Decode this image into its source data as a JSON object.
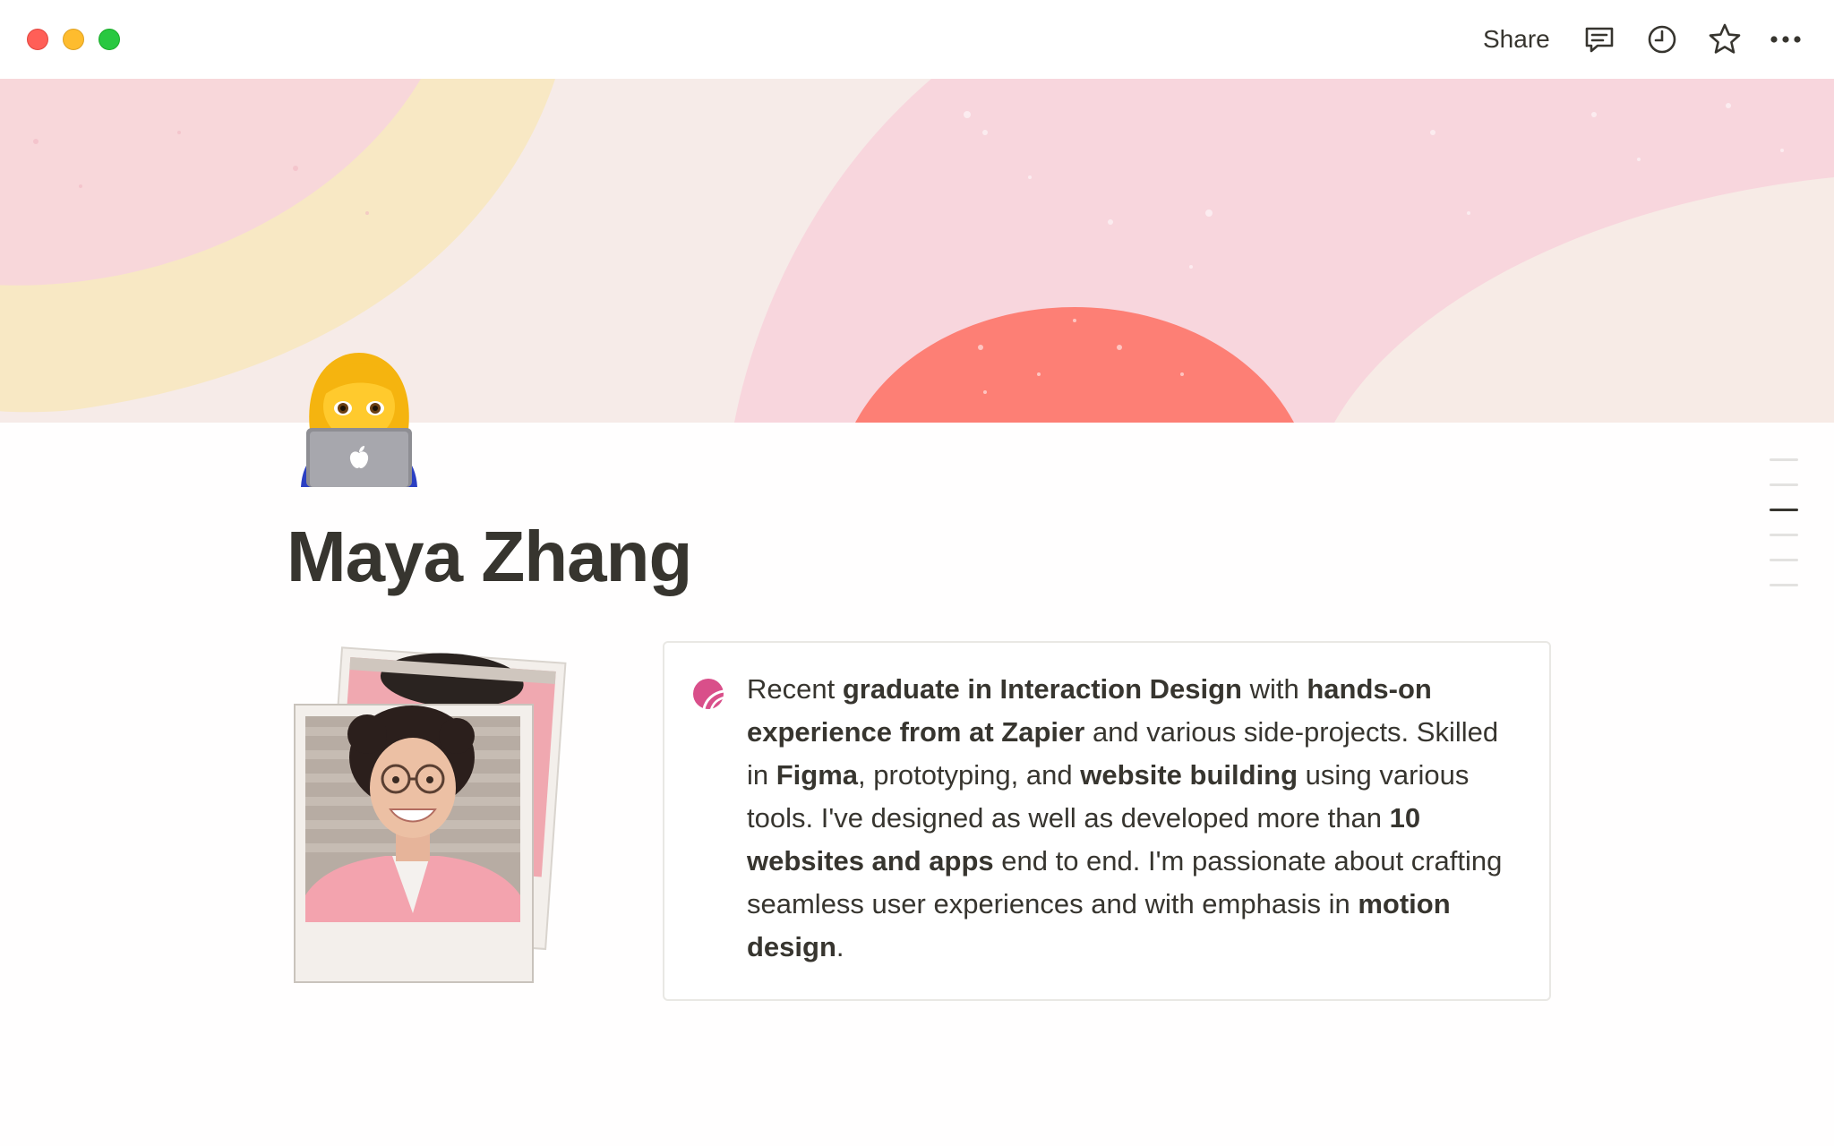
{
  "toolbar": {
    "share_label": "Share",
    "icons": [
      "comments-icon",
      "history-icon",
      "favorite-star-icon",
      "more-options-icon"
    ]
  },
  "page": {
    "icon_emoji": "woman-technologist",
    "title": "Maya Zhang"
  },
  "callout": {
    "icon": "pink-circle-icon",
    "segments": [
      {
        "text": "Recent ",
        "bold": false
      },
      {
        "text": "graduate in Interaction Design",
        "bold": true
      },
      {
        "text": " with ",
        "bold": false
      },
      {
        "text": "hands-on experience from at Zapier",
        "bold": true
      },
      {
        "text": " and various side-projects. Skilled in ",
        "bold": false
      },
      {
        "text": "Figma",
        "bold": true
      },
      {
        "text": ", prototyping, and ",
        "bold": false
      },
      {
        "text": "website building",
        "bold": true
      },
      {
        "text": " using various tools. I've designed as well as developed more than ",
        "bold": false
      },
      {
        "text": "10 websites and apps",
        "bold": true
      },
      {
        "text": " end to end. I'm passionate about crafting seamless user experiences and with emphasis in ",
        "bold": false
      },
      {
        "text": "motion design",
        "bold": true
      },
      {
        "text": ".",
        "bold": false
      }
    ]
  },
  "toc": {
    "count": 6,
    "active_index": 2
  },
  "colors": {
    "cover_bg": "#f6ebe8",
    "cover_pink": "#f8d6dd",
    "cover_yellow": "#f8e9c6",
    "cover_coral": "#fd7f75",
    "text": "#37352f",
    "callout_border": "#e9e8e4"
  }
}
